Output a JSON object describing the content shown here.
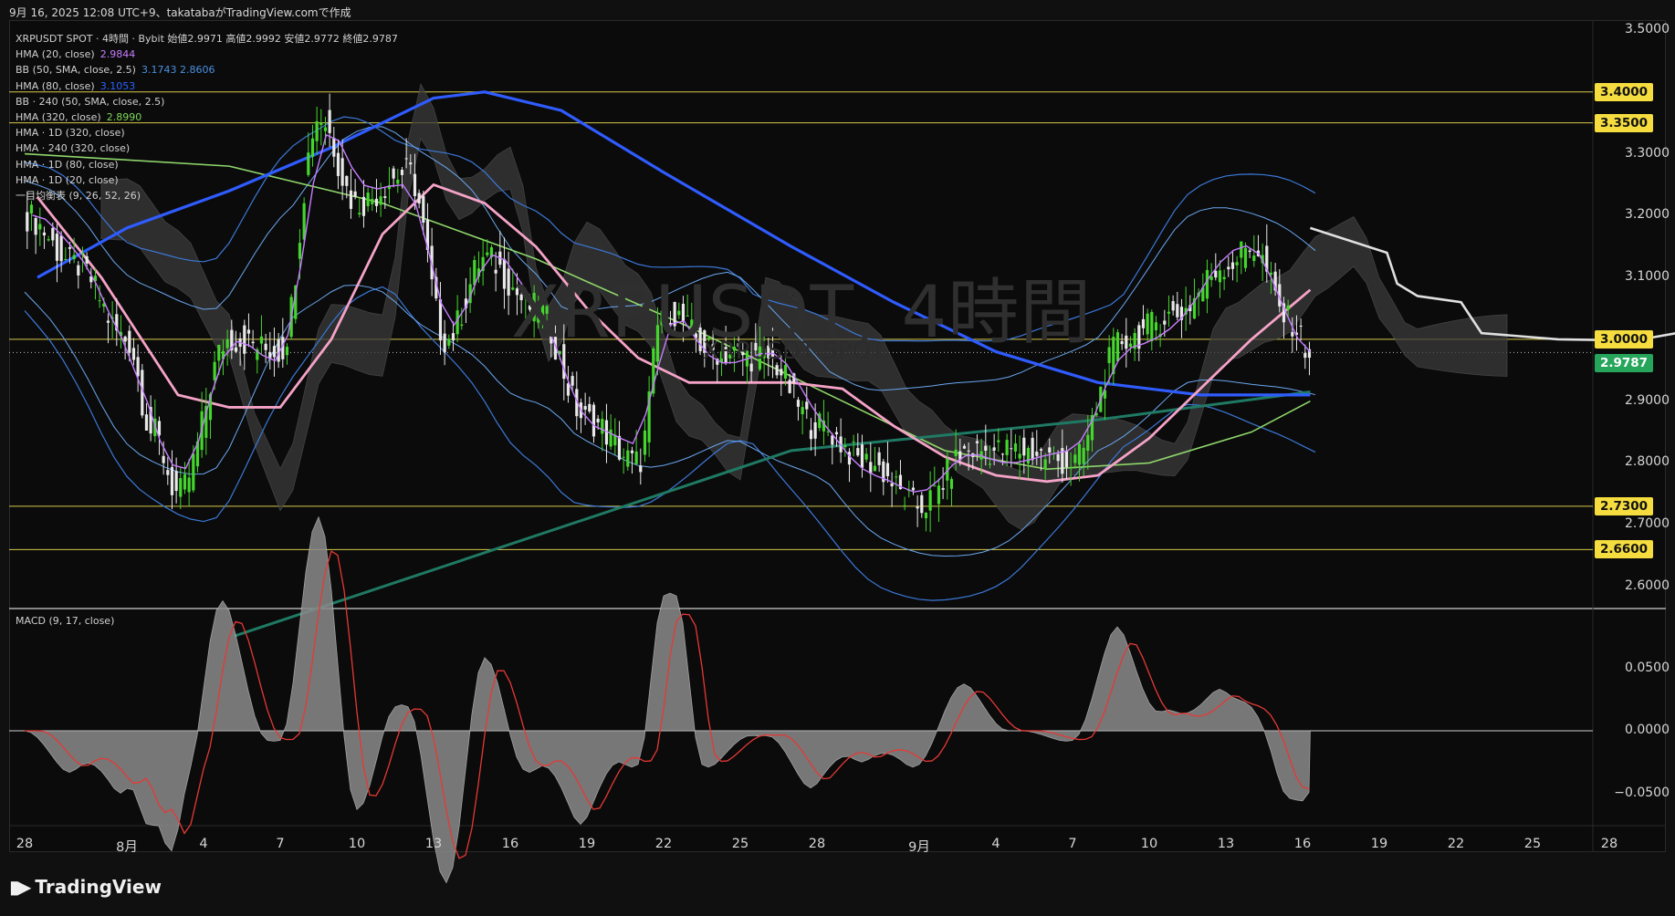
{
  "header": {
    "caption": "9月 16, 2025 12:08 UTC+9、takatabaがTradingView.comで作成"
  },
  "legend": [
    {
      "label": "XRPUSDT SPOT · 4時間 · Bybit  始値2.9971  高値2.9992  安値2.9772  終値2.9787",
      "value": "",
      "color": "#d0d0d0"
    },
    {
      "label": "HMA (20, close)",
      "value": "2.9844",
      "color": "#c77dff"
    },
    {
      "label": "BB (50, SMA, close, 2.5)",
      "value": "3.1743  2.8606",
      "color": "#4a90e2"
    },
    {
      "label": "HMA (80, close)",
      "value": "3.1053",
      "color": "#2962ff"
    },
    {
      "label": "BB · 240 (50, SMA, close, 2.5)",
      "value": "",
      "color": ""
    },
    {
      "label": "HMA (320, close)",
      "value": "2.8990",
      "color": "#7ed957"
    },
    {
      "label": "HMA · 1D (320, close)",
      "value": "",
      "color": ""
    },
    {
      "label": "HMA · 240 (320, close)",
      "value": "",
      "color": ""
    },
    {
      "label": "HMA · 1D (80, close)",
      "value": "",
      "color": ""
    },
    {
      "label": "HMA · 1D (20, close)",
      "value": "",
      "color": ""
    },
    {
      "label": "一目均衡表 (9, 26, 52, 26)",
      "value": "",
      "color": ""
    }
  ],
  "watermark": {
    "symbol": "XRPUSDT, 4時間",
    "sub": "XRPUSDT SPOT"
  },
  "macd": {
    "label": "MACD (9, 17, close)"
  },
  "price_axis": [
    "3.5000",
    "3.3000",
    "3.2000",
    "3.1000",
    "2.9000",
    "2.8000",
    "2.7000",
    "2.6000"
  ],
  "macd_axis": [
    "0.0500",
    "0.0000",
    "−0.0500"
  ],
  "levels": [
    {
      "label": "3.4000",
      "price": 3.4
    },
    {
      "label": "3.3500",
      "price": 3.35
    },
    {
      "label": "3.0000",
      "price": 3.0
    },
    {
      "label": "2.7300",
      "price": 2.73
    },
    {
      "label": "2.6600",
      "price": 2.66
    }
  ],
  "current_price": {
    "label": "2.9787",
    "price": 2.9787,
    "color": "#26a65b"
  },
  "date_axis": [
    {
      "label": "28",
      "day": 0
    },
    {
      "label": "8月",
      "day": 4
    },
    {
      "label": "4",
      "day": 7
    },
    {
      "label": "7",
      "day": 10
    },
    {
      "label": "10",
      "day": 13
    },
    {
      "label": "13",
      "day": 16
    },
    {
      "label": "16",
      "day": 19
    },
    {
      "label": "19",
      "day": 22
    },
    {
      "label": "22",
      "day": 25
    },
    {
      "label": "25",
      "day": 28
    },
    {
      "label": "28",
      "day": 31
    },
    {
      "label": "9月",
      "day": 35
    },
    {
      "label": "4",
      "day": 38
    },
    {
      "label": "7",
      "day": 41
    },
    {
      "label": "10",
      "day": 44
    },
    {
      "label": "13",
      "day": 47
    },
    {
      "label": "16",
      "day": 50
    },
    {
      "label": "19",
      "day": 53
    },
    {
      "label": "22",
      "day": 56
    },
    {
      "label": "25",
      "day": 59
    },
    {
      "label": "28",
      "day": 62
    }
  ],
  "footer": {
    "brand": "TradingView"
  },
  "colors": {
    "up": "#44d62c",
    "down": "#e8e8e8",
    "level": "#d8c94a",
    "hma20": "#c77dff",
    "hma80": "#2f5cff",
    "bb": "#3c78d8",
    "hma320": "#8fd66b",
    "pink": "#f5a3c7",
    "teal": "#1f7a64",
    "forecast": "#e0e0e0",
    "cloud": "#3a3a3a"
  },
  "chart_data": {
    "type": "candlestick",
    "symbol": "XRPUSDT SPOT",
    "timeframe": "4時間",
    "ohlc_last": {
      "open": 2.9971,
      "high": 2.9992,
      "low": 2.9772,
      "close": 2.9787
    },
    "ylim": [
      2.55,
      3.52
    ],
    "macd_ylim": [
      -0.075,
      0.09
    ],
    "key_closes": [
      {
        "day": 0,
        "price": 3.2
      },
      {
        "day": 2,
        "price": 3.12
      },
      {
        "day": 4,
        "price": 3.0
      },
      {
        "day": 5,
        "price": 2.85
      },
      {
        "day": 6,
        "price": 2.75
      },
      {
        "day": 8,
        "price": 3.0
      },
      {
        "day": 10,
        "price": 2.98
      },
      {
        "day": 11.5,
        "price": 3.36
      },
      {
        "day": 13,
        "price": 3.22
      },
      {
        "day": 15,
        "price": 3.27
      },
      {
        "day": 16.5,
        "price": 3.0
      },
      {
        "day": 18,
        "price": 3.13
      },
      {
        "day": 20,
        "price": 3.05
      },
      {
        "day": 22,
        "price": 2.87
      },
      {
        "day": 24,
        "price": 2.8
      },
      {
        "day": 25,
        "price": 3.05
      },
      {
        "day": 27,
        "price": 2.98
      },
      {
        "day": 29,
        "price": 2.97
      },
      {
        "day": 31,
        "price": 2.86
      },
      {
        "day": 33,
        "price": 2.8
      },
      {
        "day": 35,
        "price": 2.73
      },
      {
        "day": 37,
        "price": 2.82
      },
      {
        "day": 39,
        "price": 2.82
      },
      {
        "day": 41,
        "price": 2.8
      },
      {
        "day": 43,
        "price": 3.0
      },
      {
        "day": 45,
        "price": 3.04
      },
      {
        "day": 47,
        "price": 3.12
      },
      {
        "day": 48,
        "price": 3.15
      },
      {
        "day": 49.5,
        "price": 3.03
      },
      {
        "day": 50.3,
        "price": 2.98
      }
    ]
  }
}
